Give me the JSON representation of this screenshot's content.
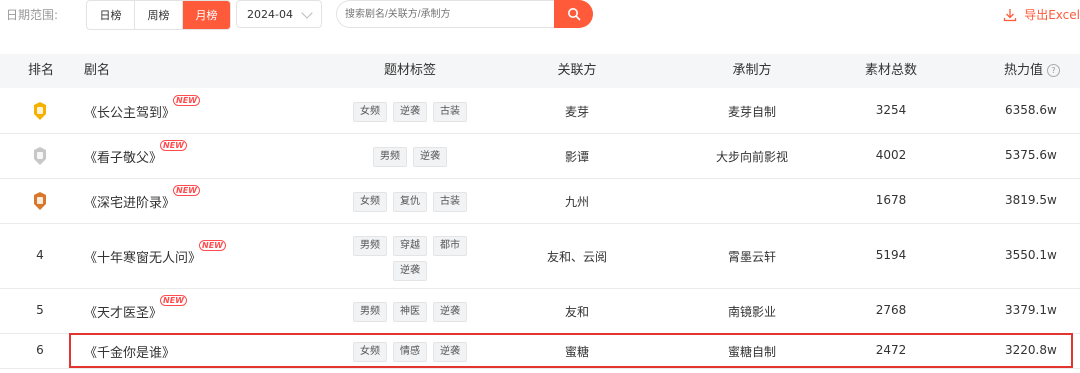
{
  "filter": {
    "date_label": "日期范围:",
    "tabs": [
      "日榜",
      "周榜",
      "月榜"
    ],
    "active_tab": 2,
    "month": "2024-04",
    "search_placeholder": "搜索剧名/关联方/承制方",
    "export_label": "导出Excel"
  },
  "table": {
    "headers": {
      "rank": "排名",
      "title": "剧名",
      "tags": "题材标签",
      "partner": "关联方",
      "producer": "承制方",
      "materials": "素材总数",
      "heat": "热力值"
    },
    "new_badge": "NEW",
    "rows": [
      {
        "rank": "1",
        "medal": "gold-medal-icon",
        "title": "《长公主驾到》",
        "is_new": true,
        "tags": [
          "女频",
          "逆袭",
          "古装"
        ],
        "partner": "麦芽",
        "producer": "麦芽自制",
        "materials": "3254",
        "heat": "6358.6w"
      },
      {
        "rank": "2",
        "medal": "silver-medal-icon",
        "title": "《看子敬父》",
        "is_new": true,
        "tags": [
          "男频",
          "逆袭"
        ],
        "partner": "影谭",
        "producer": "大步向前影视",
        "materials": "4002",
        "heat": "5375.6w"
      },
      {
        "rank": "3",
        "medal": "bronze-medal-icon",
        "title": "《深宅进阶录》",
        "is_new": true,
        "tags": [
          "女频",
          "复仇",
          "古装"
        ],
        "partner": "九州",
        "producer": "",
        "materials": "1678",
        "heat": "3819.5w"
      },
      {
        "rank": "4",
        "medal": "",
        "title": "《十年寒窗无人问》",
        "is_new": true,
        "tags": [
          "男频",
          "穿越",
          "都市",
          "逆袭"
        ],
        "partner": "友和、云阅",
        "producer": "霄墨云轩",
        "materials": "5194",
        "heat": "3550.1w"
      },
      {
        "rank": "5",
        "medal": "",
        "title": "《天才医圣》",
        "is_new": true,
        "tags": [
          "男频",
          "神医",
          "逆袭"
        ],
        "partner": "友和",
        "producer": "南镜影业",
        "materials": "2768",
        "heat": "3379.1w"
      },
      {
        "rank": "6",
        "medal": "",
        "title": "《千金你是谁》",
        "is_new": false,
        "tags": [
          "女频",
          "情感",
          "逆袭"
        ],
        "partner": "蜜糖",
        "producer": "蜜糖自制",
        "materials": "2472",
        "heat": "3220.8w"
      }
    ]
  },
  "colors": {
    "accent": "#ff5a3a",
    "highlight_border": "#e3342f",
    "gold": "#f5b000",
    "silver": "#c7c7c7",
    "bronze": "#d9782d"
  }
}
